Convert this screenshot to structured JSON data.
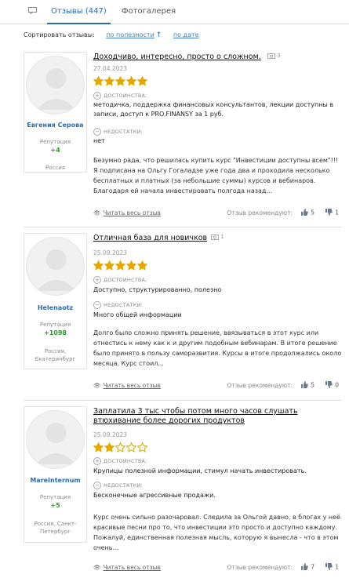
{
  "tabs": {
    "reviews": "Отзывы (447)",
    "gallery": "Фотогалерея"
  },
  "sort": {
    "label": "Сортировать отзывы:",
    "by_usefulness": "по полезности",
    "by_date": "по дате"
  },
  "labels": {
    "pros": "ДОСТОИНСТВА:",
    "cons": "НЕДОСТАТКИ:",
    "reputation": "Репутация",
    "read_all": "Читать весь отзыв",
    "recommend": "Отзыв рекомендуют:"
  },
  "reviews": [
    {
      "user": "Евгения Серова",
      "reputation": "+4",
      "city": "Россия",
      "title": "Доходчиво, интересно, просто о сложном.",
      "photos": "3",
      "date": "27.04.2023",
      "rating": 5,
      "pros": "методичка, поддержка финансовых консультантов, лекции доступны в записи, доступ к PRO.FINANSY за 1 руб.",
      "cons": "нет",
      "text": "Безумно рада, что решилась купить курс \"Инвестиции доступны всем\"!!! Я подписана на Ольгу Гогаладзе уже года два и проходила несколько бесплатных и платных (за небольшие суммы) курсов и вебинаров. Благодаря ей начала инвестировать полгода назад...",
      "likes": "5",
      "dislikes": "1"
    },
    {
      "user": "Helenaotz",
      "reputation": "+1098",
      "city": "Россия, Екатеринбург",
      "title": "Отличная база для новичков",
      "photos": "1",
      "date": "25.09.2023",
      "rating": 5,
      "pros": "Доступно, структурированно, полезно",
      "cons": "Много общей информации",
      "text": "Долго было сложно принять решение, ввязываться в этот курс или отнестись к нему как к и другим подобным вебинарам. В итоге решение было принято в пользу саморазвития. Курсы в итоге продолжались около месяца. Курс стоил...",
      "likes": "5",
      "dislikes": "0"
    },
    {
      "user": "MareInternum",
      "reputation": "+5",
      "city": "Россия, Санкт-Петербург",
      "title": "Заплатила 3 тыс чтобы потом много часов слушать втюхивание более дорогих продуктов",
      "photos": "",
      "date": "25.09.2023",
      "rating": 2,
      "pros": "Крупицы полезной информации, стимул начать инвестировать.",
      "cons": "Бесконечные агрессивные продажи.",
      "text": "Курс очень сильно разочаровал. Следила за Ольгой давно, в блогах у неё красивые песни про то, что инвестиции это просто и доступно каждому. Пожалуй, единственная полезная мысль, которую я вынесла - что в этом очень...",
      "likes": "7",
      "dislikes": "1"
    }
  ],
  "colors": {
    "accent": "#2a6db5",
    "star": "#e6a800",
    "reputation": "#2c9a2c"
  }
}
